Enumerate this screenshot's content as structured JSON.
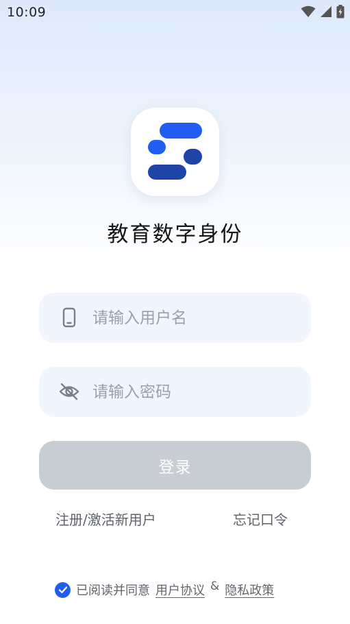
{
  "status_bar": {
    "time": "10:09"
  },
  "app": {
    "title": "教育数字身份",
    "brand_colors": {
      "primary": "#1f5ef0",
      "secondary": "#1e44a8"
    }
  },
  "form": {
    "username": {
      "placeholder": "请输入用户名",
      "value": "",
      "icon": "phone-icon"
    },
    "password": {
      "placeholder": "请输入密码",
      "value": "",
      "icon": "eye-off-icon"
    },
    "login_label": "登录",
    "login_button_color": "#c8cdd3"
  },
  "links": {
    "register": "注册/激活新用户",
    "forgot": "忘记口令"
  },
  "agreement": {
    "checked": true,
    "prefix": "已阅读并同意",
    "user_agreement": "用户协议",
    "separator": "&",
    "privacy_policy": "隐私政策"
  }
}
